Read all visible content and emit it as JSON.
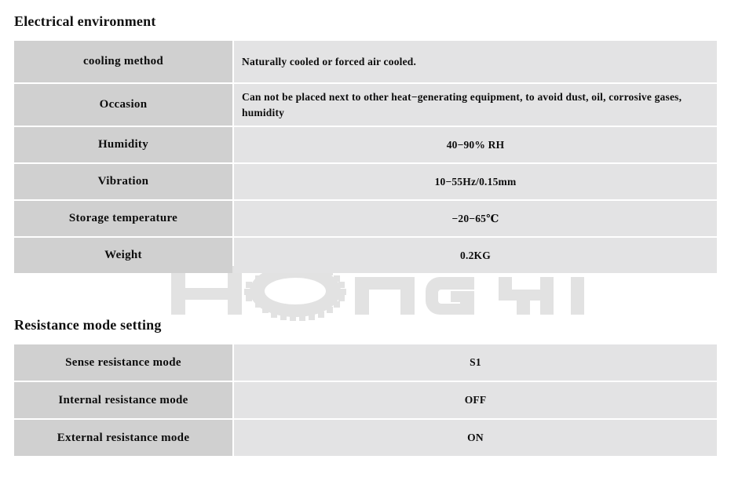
{
  "document": {
    "watermark": {
      "text_left": "HONG",
      "text_right": "YI",
      "logo_icon": "gear-icon",
      "color": "#e2e2e2"
    },
    "colors": {
      "label_cell_bg": "#d0d0d0",
      "value_cell_bg": "#e3e3e4",
      "page_bg": "#ffffff",
      "text": "#0d0d0d"
    }
  },
  "sections": [
    {
      "id": "electrical-environment",
      "heading": "Electrical environment",
      "rows": [
        {
          "label": "cooling method",
          "value": "Naturally cooled or forced air cooled.",
          "align": "left"
        },
        {
          "label": "Occasion",
          "value": "Can not be placed next to other heat−generating equipment, to avoid dust, oil, corrosive gases, humidity",
          "align": "left"
        },
        {
          "label": "Humidity",
          "value": "40−90% RH",
          "align": "center"
        },
        {
          "label": "Vibration",
          "value": "10−55Hz/0.15mm",
          "align": "center"
        },
        {
          "label": "Storage temperature",
          "value": "−20−65℃",
          "align": "center"
        },
        {
          "label": "Weight",
          "value": "0.2KG",
          "align": "center"
        }
      ]
    },
    {
      "id": "resistance-mode-setting",
      "heading": "Resistance mode setting",
      "rows": [
        {
          "label": "Sense resistance mode",
          "value": "S1",
          "align": "center"
        },
        {
          "label": "Internal resistance mode",
          "value": "OFF",
          "align": "center"
        },
        {
          "label": "External resistance mode",
          "value": "ON",
          "align": "center"
        }
      ]
    }
  ]
}
